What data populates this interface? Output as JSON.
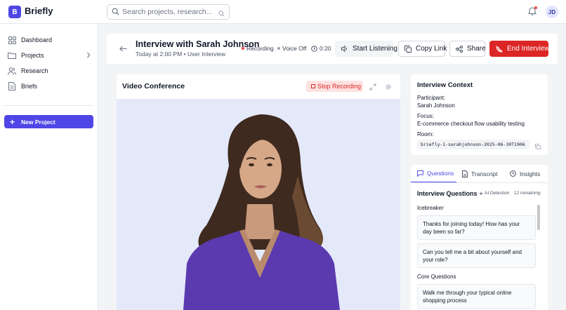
{
  "app": {
    "logo_letter": "B",
    "name": "Briefly"
  },
  "search": {
    "placeholder": "Search projects, research..."
  },
  "user": {
    "initials": "JD"
  },
  "sidebar": {
    "items": [
      {
        "label": "Dashboard",
        "icon": "grid-icon"
      },
      {
        "label": "Projects",
        "icon": "folder-icon"
      },
      {
        "label": "Research",
        "icon": "users-icon"
      },
      {
        "label": "Briefs",
        "icon": "file-icon"
      }
    ],
    "new_project": "New Project"
  },
  "interview": {
    "title": "Interview with Sarah Johnson",
    "subtitle": "Today at 2:00 PM • User Interview",
    "recording_label": "Recording",
    "voice_label": "Voice Off",
    "timer": "0:20",
    "start_listening": "Start Listening",
    "copy_link": "Copy Link",
    "share": "Share",
    "end_interview": "End Interview"
  },
  "video": {
    "title": "Video Conference",
    "stop_recording": "Stop Recording"
  },
  "context": {
    "title": "Interview Context",
    "participant_label": "Participant:",
    "participant": "Sarah Johnson",
    "focus_label": "Focus:",
    "focus": "E-commerce checkout flow usability testing",
    "room_label": "Room:",
    "room": "briefly-1-sarahjohnson-2025-06-30T1906"
  },
  "questions_panel": {
    "tabs": [
      "Questions",
      "Transcript",
      "Insights"
    ],
    "title": "Interview Questions",
    "ai_detection": "AI Detection",
    "remaining": "12 remaining",
    "sections": [
      {
        "label": "Icebreaker",
        "items": [
          "Thanks for joining today! How has your day been so far?",
          "Can you tell me a bit about yourself and your role?"
        ]
      },
      {
        "label": "Core Questions",
        "items": [
          "Walk me through your typical online shopping process"
        ]
      }
    ]
  },
  "colors": {
    "accent": "#4f46e5",
    "danger": "#dc2626",
    "recording_dot": "#ef4444",
    "voice_dot": "#9ca3af"
  }
}
